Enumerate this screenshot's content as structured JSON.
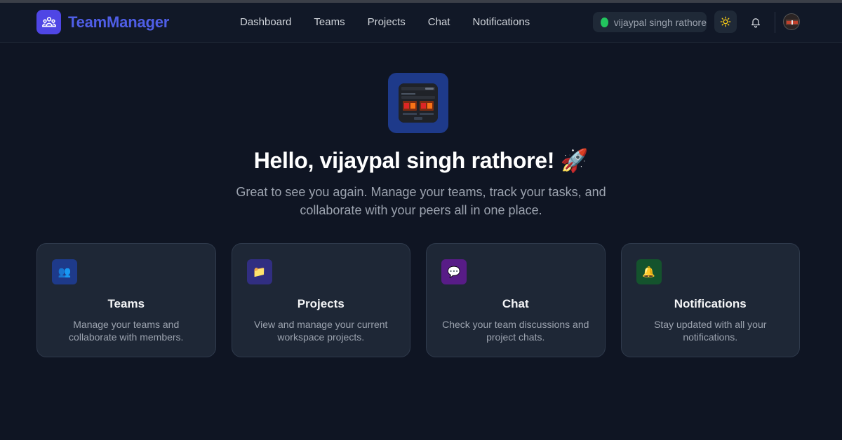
{
  "app": {
    "name": "TeamManager",
    "brand_color": "#4f5ee6"
  },
  "nav": {
    "items": [
      {
        "label": "Dashboard"
      },
      {
        "label": "Teams"
      },
      {
        "label": "Projects"
      },
      {
        "label": "Chat"
      },
      {
        "label": "Notifications"
      }
    ]
  },
  "user": {
    "name": "vijaypal singh rathore",
    "status_color": "#22c55e"
  },
  "hero": {
    "title": "Hello, vijaypal singh rathore! 🚀",
    "subtitle": "Great to see you again. Manage your teams, track your tasks, and collaborate with your peers all in one place."
  },
  "cards": [
    {
      "title": "Teams",
      "description": "Manage your teams and collaborate with members.",
      "icon": "👥",
      "icon_bg": "#1e3a8a"
    },
    {
      "title": "Projects",
      "description": "View and manage your current workspace projects.",
      "icon": "📁",
      "icon_bg": "#312e81"
    },
    {
      "title": "Chat",
      "description": "Check your team discussions and project chats.",
      "icon": "💬",
      "icon_bg": "#581c87"
    },
    {
      "title": "Notifications",
      "description": "Stay updated with all your notifications.",
      "icon": "🔔",
      "icon_bg": "#14532d"
    }
  ],
  "icons": {
    "logo": "team-icon",
    "theme": "sun-icon",
    "bell": "bell-icon"
  }
}
